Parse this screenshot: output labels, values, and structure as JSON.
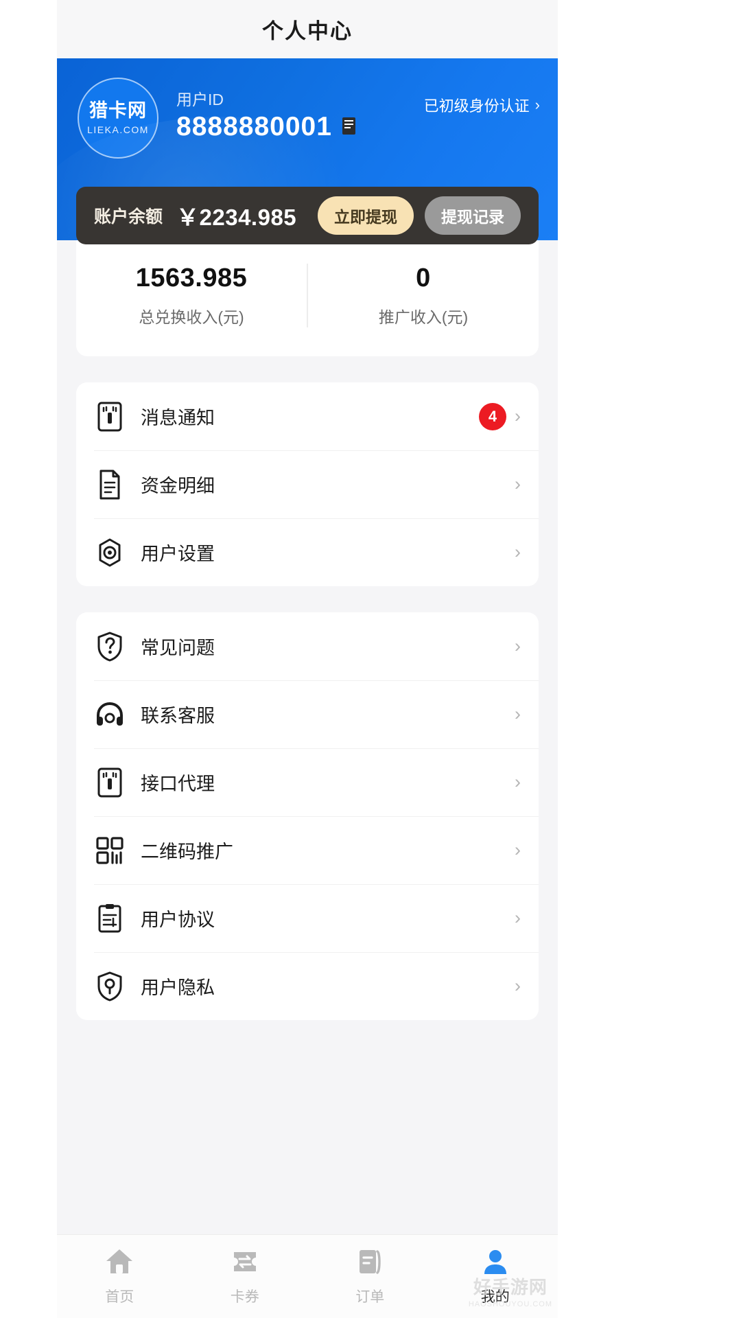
{
  "header": {
    "title": "个人中心"
  },
  "profile": {
    "avatar_cn": "猎卡网",
    "avatar_en": "LIEKA.COM",
    "uid_label": "用户ID",
    "uid_value": "8888880001",
    "copy_icon": "copy-icon",
    "verify_text": "已初级身份认证",
    "verify_chevron": "›"
  },
  "balance": {
    "label": "账户余额",
    "amount": "￥2234.985",
    "withdraw_button": "立即提现",
    "record_button": "提现记录",
    "bar_color": "#383532",
    "withdraw_color": "#f8e2b4",
    "record_color": "#9a9a9a"
  },
  "stats": [
    {
      "value": "1563.985",
      "label": "总兑换收入(元)"
    },
    {
      "value": "0",
      "label": "推广收入(元)"
    }
  ],
  "menu_group_1": [
    {
      "icon": "notification-icon",
      "label": "消息通知",
      "badge": "4",
      "chevron": "›"
    },
    {
      "icon": "document-icon",
      "label": "资金明细",
      "badge": "",
      "chevron": "›"
    },
    {
      "icon": "settings-gear-icon",
      "label": "用户设置",
      "badge": "",
      "chevron": "›"
    }
  ],
  "menu_group_2": [
    {
      "icon": "question-shield-icon",
      "label": "常见问题",
      "badge": "",
      "chevron": "›"
    },
    {
      "icon": "headset-support-icon",
      "label": "联系客服",
      "badge": "",
      "chevron": "›"
    },
    {
      "icon": "api-interface-icon",
      "label": "接口代理",
      "badge": "",
      "chevron": "›"
    },
    {
      "icon": "qrcode-icon",
      "label": "二维码推广",
      "badge": "",
      "chevron": "›"
    },
    {
      "icon": "agreement-icon",
      "label": "用户协议",
      "badge": "",
      "chevron": "›"
    },
    {
      "icon": "privacy-shield-icon",
      "label": "用户隐私",
      "badge": "",
      "chevron": "›"
    }
  ],
  "tabbar": {
    "active_color": "#2b8cf0",
    "inactive_color": "#b9b9b9",
    "items": [
      {
        "icon": "home-icon",
        "label": "首页",
        "active": false
      },
      {
        "icon": "ticket-icon",
        "label": "卡券",
        "active": false
      },
      {
        "icon": "order-list-icon",
        "label": "订单",
        "active": false
      },
      {
        "icon": "user-person-icon",
        "label": "我的",
        "active": true
      }
    ]
  },
  "watermark": {
    "main": "好手游网",
    "sub": "HAOSHOUYOU.COM"
  }
}
